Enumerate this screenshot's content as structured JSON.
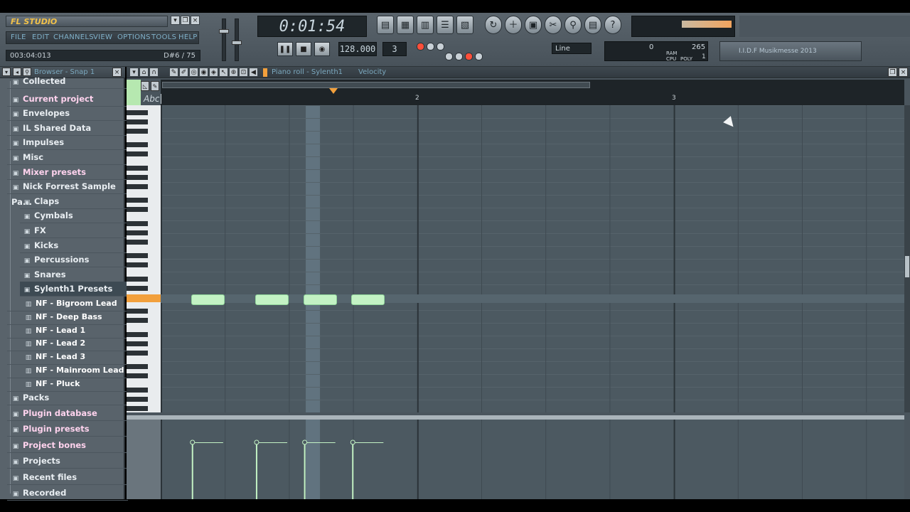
{
  "app": {
    "logo": "FL STUDIO",
    "menus": [
      "FILE",
      "EDIT",
      "CHANNELS",
      "VIEW",
      "OPTIONS",
      "TOOLS",
      "HELP"
    ],
    "hint_time": "003:04:013",
    "hint_note": "D#6 / 75"
  },
  "transport": {
    "time": "0:01:54",
    "tempo": "128.000",
    "pattern": "3",
    "snap_line": "Line"
  },
  "meters": {
    "cpu_value": "265",
    "ram_value": "0",
    "poly_value": "1",
    "cpu_label": "CPU",
    "ram_label": "RAM",
    "poly_label": "POLY"
  },
  "news": "I.I.D.F Musikmesse 2013",
  "browser": {
    "title": "Browser - Snap 1",
    "items": [
      {
        "label": "Collected",
        "icon": "folder",
        "kind": "top"
      },
      {
        "label": "Current project",
        "icon": "folder",
        "kind": "top-pink"
      },
      {
        "label": "Envelopes",
        "icon": "folder",
        "kind": "top"
      },
      {
        "label": "IL Shared Data",
        "icon": "folder",
        "kind": "top"
      },
      {
        "label": "Impulses",
        "icon": "folder",
        "kind": "top"
      },
      {
        "label": "Misc",
        "icon": "folder",
        "kind": "top"
      },
      {
        "label": "Mixer presets",
        "icon": "folder",
        "kind": "top-pink"
      },
      {
        "label": "Nick Forrest Sample Pa...",
        "icon": "folder",
        "kind": "top"
      },
      {
        "label": "Claps",
        "icon": "folder",
        "kind": "sub"
      },
      {
        "label": "Cymbals",
        "icon": "folder",
        "kind": "sub"
      },
      {
        "label": "FX",
        "icon": "folder",
        "kind": "sub"
      },
      {
        "label": "Kicks",
        "icon": "folder",
        "kind": "sub"
      },
      {
        "label": "Percussions",
        "icon": "folder",
        "kind": "sub"
      },
      {
        "label": "Snares",
        "icon": "folder",
        "kind": "sub"
      },
      {
        "label": "Sylenth1 Presets",
        "icon": "folder",
        "kind": "sub-sel"
      },
      {
        "label": "NF - Bigroom Lead",
        "icon": "preset",
        "kind": "item"
      },
      {
        "label": "NF - Deep Bass",
        "icon": "preset",
        "kind": "item"
      },
      {
        "label": "NF - Lead 1",
        "icon": "preset",
        "kind": "item"
      },
      {
        "label": "NF - Lead 2",
        "icon": "preset",
        "kind": "item"
      },
      {
        "label": "NF - Lead 3",
        "icon": "preset",
        "kind": "item"
      },
      {
        "label": "NF - Mainroom Lead",
        "icon": "preset",
        "kind": "item"
      },
      {
        "label": "NF - Pluck",
        "icon": "preset",
        "kind": "item"
      },
      {
        "label": "Packs",
        "icon": "folder",
        "kind": "top"
      },
      {
        "label": "Plugin database",
        "icon": "folder",
        "kind": "top-pink"
      },
      {
        "label": "Plugin presets",
        "icon": "folder",
        "kind": "top-pink"
      },
      {
        "label": "Project bones",
        "icon": "folder",
        "kind": "top-pink"
      },
      {
        "label": "Projects",
        "icon": "folder",
        "kind": "top"
      },
      {
        "label": "Recent files",
        "icon": "folder",
        "kind": "top"
      },
      {
        "label": "Recorded",
        "icon": "folder",
        "kind": "top"
      }
    ]
  },
  "pianoroll": {
    "title": "Piano roll - Sylenth1",
    "target": "Velocity",
    "bars": [
      "2",
      "3"
    ],
    "abc": "Abc",
    "notes_key": "C5",
    "notes_start_beats": [
      1.25,
      2.25,
      3.0,
      3.75
    ],
    "note_length_beats": 0.5,
    "velocity": [
      0.75,
      0.75,
      0.75,
      0.75
    ],
    "playhead_beat": 2.75
  }
}
